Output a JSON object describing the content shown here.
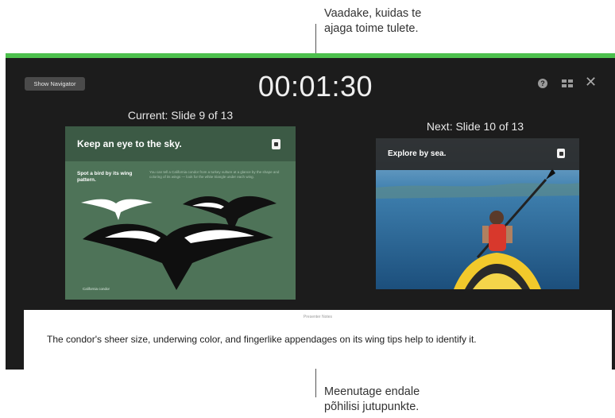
{
  "callouts": {
    "top_line1": "Vaadake, kuidas te",
    "top_line2": "ajaga toime tulete.",
    "bottom_line1": "Meenutage endale",
    "bottom_line2": "põhilisi jutupunkte."
  },
  "toolbar": {
    "show_navigator_label": "Show Navigator",
    "timer": "00:01:30",
    "help_icon": "question-icon",
    "layout_icon": "layout-icon",
    "close_icon": "close-icon"
  },
  "current": {
    "label": "Current: Slide 9 of 13",
    "title": "Keep an eye to the sky.",
    "subtitle": "Spot a bird by its wing pattern.",
    "body": "You can tell a California condor from a turkey vulture at a glance by the shape and coloring of its wings — look for the white triangle under each wing.",
    "caption": "California condor"
  },
  "next": {
    "label": "Next: Slide 10 of 13",
    "title": "Explore by sea."
  },
  "notes": {
    "label": "Presenter Notes",
    "text": "The condor's sheer size, underwing color, and fingerlike appendages on its wing tips help to identify it."
  },
  "colors": {
    "accent_green": "#4dc04d",
    "window_bg": "#1c1c1c",
    "slide_green": "#4e7358"
  }
}
